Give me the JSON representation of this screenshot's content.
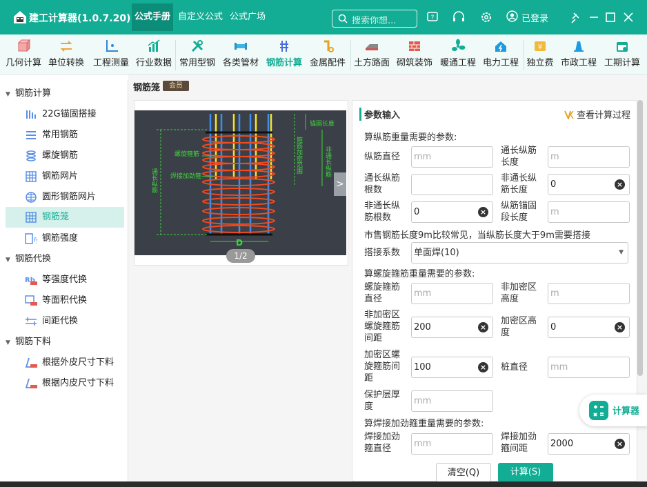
{
  "app": {
    "title": "建工计算器(1.0.7.20)"
  },
  "top_tabs": [
    {
      "label": "公式手册"
    },
    {
      "label": "自定义公式"
    },
    {
      "label": "公式广场"
    }
  ],
  "search": {
    "placeholder": "搜索你想..."
  },
  "account": {
    "status": "已登录"
  },
  "toolbar": {
    "items": [
      {
        "label": "几何计算",
        "icon": "cube-icon"
      },
      {
        "label": "单位转换",
        "icon": "unit-convert-icon"
      },
      {
        "label": "工程测量",
        "icon": "survey-axes-icon"
      },
      {
        "label": "行业数据",
        "icon": "chart-data-icon"
      },
      {
        "label": "常用型钢",
        "icon": "wrench-tools-icon"
      },
      {
        "label": "各类管材",
        "icon": "pipe-icon"
      },
      {
        "label": "钢筋计算",
        "icon": "rebar-icon"
      },
      {
        "label": "金属配件",
        "icon": "metal-fitting-icon"
      },
      {
        "label": "土方路面",
        "icon": "earthwork-icon"
      },
      {
        "label": "砌筑装饰",
        "icon": "brick-icon"
      },
      {
        "label": "暖通工程",
        "icon": "fan-icon"
      },
      {
        "label": "电力工程",
        "icon": "power-house-icon"
      },
      {
        "label": "独立费",
        "icon": "fee-icon"
      },
      {
        "label": "市政工程",
        "icon": "municipal-icon"
      },
      {
        "label": "工期计算",
        "icon": "calendar-icon"
      }
    ],
    "active": "钢筋计算"
  },
  "sidebar": {
    "groups": [
      {
        "label": "钢筋计算"
      },
      {
        "label": "钢筋代换"
      },
      {
        "label": "钢筋下料"
      }
    ],
    "items": [
      {
        "label": "22G锚固搭接"
      },
      {
        "label": "常用钢筋"
      },
      {
        "label": "螺旋钢筋"
      },
      {
        "label": "钢筋网片"
      },
      {
        "label": "圆形钢筋网片"
      },
      {
        "label": "钢筋笼"
      },
      {
        "label": "钢筋强度"
      },
      {
        "label": "等强度代换"
      },
      {
        "label": "等面积代换"
      },
      {
        "label": "间距代换"
      },
      {
        "label": "根据外皮尺寸下料"
      },
      {
        "label": "根据内皮尺寸下料"
      }
    ],
    "active": "钢筋笼"
  },
  "page": {
    "title": "钢筋笼",
    "badge": "会员"
  },
  "diagram": {
    "labels": {
      "anchor_length": "锚固长度",
      "dense_range": "箍筋加密范围",
      "non_through": "非通长纵筋",
      "spiral": "螺旋箍筋",
      "weld_ring": "焊接加劲箍",
      "through": "通长纵筋",
      "diameter": "D"
    },
    "pager": "1/2",
    "next": ">"
  },
  "form": {
    "title": "参数输入",
    "view_process": "查看计算过程",
    "section1": "算纵筋重量需要的参数:",
    "section2": "算螺旋箍筋重量需要的参数:",
    "section3": "算焊接加劲箍重量需要的参数:",
    "note": "市售钢筋长度9m比较常见，当纵筋长度大于9m需要搭接",
    "fields": {
      "long_dia": {
        "label": "纵筋直径",
        "placeholder": "mm",
        "value": ""
      },
      "through_len": {
        "label": "通长纵筋长度",
        "placeholder": "m",
        "value": ""
      },
      "through_count": {
        "label": "通长纵筋根数",
        "placeholder": "",
        "value": ""
      },
      "nonthrough_len": {
        "label": "非通长纵筋长度",
        "placeholder": "",
        "value": "0"
      },
      "nonthrough_count": {
        "label": "非通长纵筋根数",
        "placeholder": "",
        "value": "0"
      },
      "anchor_seg": {
        "label": "纵筋锚固段长度",
        "placeholder": "m",
        "value": ""
      },
      "spiral_dia": {
        "label": "螺旋箍筋直径",
        "placeholder": "mm",
        "value": ""
      },
      "nondense_height": {
        "label": "非加密区高度",
        "placeholder": "m",
        "value": ""
      },
      "nondense_spacing": {
        "label": "非加密区螺旋箍筋间距",
        "placeholder": "",
        "value": "200"
      },
      "dense_height": {
        "label": "加密区高度",
        "placeholder": "",
        "value": "0"
      },
      "dense_spacing": {
        "label": "加密区螺旋箍筋间距",
        "placeholder": "",
        "value": "100"
      },
      "pile_dia": {
        "label": "桩直径",
        "placeholder": "mm",
        "value": ""
      },
      "cover": {
        "label": "保护层厚度",
        "placeholder": "mm",
        "value": ""
      },
      "weld_dia": {
        "label": "焊接加劲箍直径",
        "placeholder": "mm",
        "value": ""
      },
      "weld_spacing": {
        "label": "焊接加劲箍间距",
        "placeholder": "",
        "value": "2000"
      }
    },
    "splice": {
      "label": "搭接系数",
      "value": "单面焊(10)"
    },
    "buttons": {
      "clear": "清空(Q)",
      "calc": "计算(S)"
    }
  },
  "float_button": {
    "label": "计算器"
  },
  "colors": {
    "accent": "#12ad94",
    "active_bg": "#d6f1ec"
  }
}
